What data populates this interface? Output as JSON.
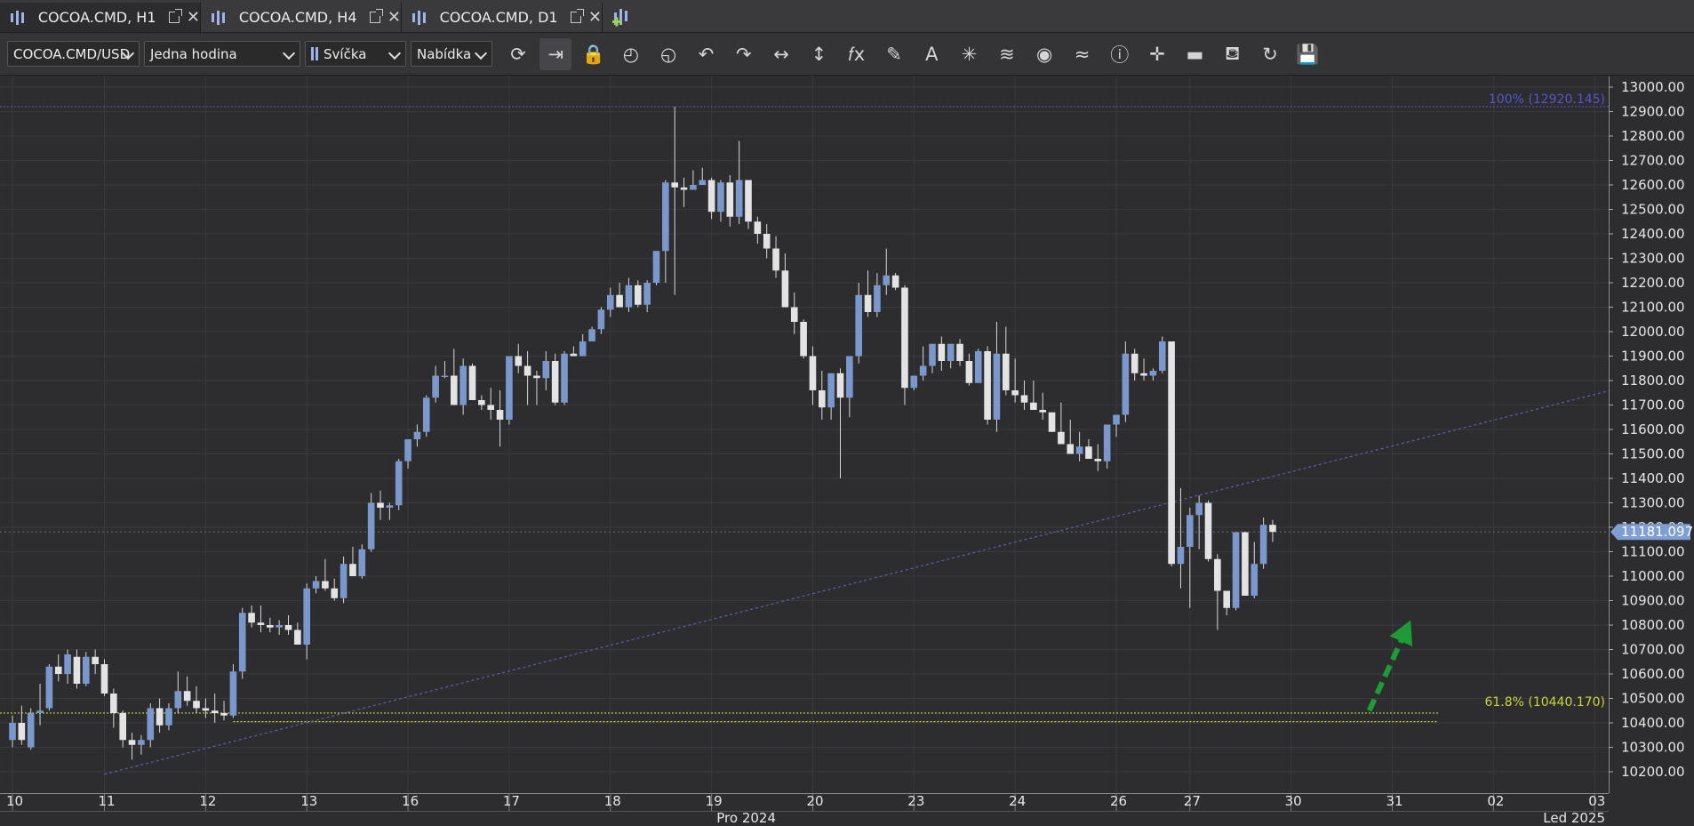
{
  "tabs": [
    {
      "label": "COCOA.CMD, H1",
      "active": true
    },
    {
      "label": "COCOA.CMD, H4",
      "active": false
    },
    {
      "label": "COCOA.CMD, D1",
      "active": false
    }
  ],
  "toolbar": {
    "instrument": "COCOA.CMD/USD",
    "period": "Jedna hodina",
    "chart_type": "Svíčka",
    "price_side": "Nabídka",
    "tools": [
      {
        "name": "refresh-icon",
        "glyph": "⟳"
      },
      {
        "name": "shift-chart-icon",
        "glyph": "⇥"
      },
      {
        "name": "lock-icon",
        "glyph": "🔒"
      },
      {
        "name": "zoom-icon",
        "glyph": "◴"
      },
      {
        "name": "zoom-out-icon",
        "glyph": "◵"
      },
      {
        "name": "undo-icon",
        "glyph": "↶"
      },
      {
        "name": "redo-icon",
        "glyph": "↷"
      },
      {
        "name": "horizontal-scale-icon",
        "glyph": "↔"
      },
      {
        "name": "vertical-scale-icon",
        "glyph": "↕"
      },
      {
        "name": "indicators-icon",
        "glyph": "𝑓x"
      },
      {
        "name": "pencil-icon",
        "glyph": "✎"
      },
      {
        "name": "text-tool-icon",
        "glyph": "A"
      },
      {
        "name": "fan-tool-icon",
        "glyph": "✳"
      },
      {
        "name": "layers-icon",
        "glyph": "≋"
      },
      {
        "name": "eye-icon",
        "glyph": "◉"
      },
      {
        "name": "chart-settings-icon",
        "glyph": "≈"
      },
      {
        "name": "info-icon",
        "glyph": "ⓘ"
      },
      {
        "name": "crosshair-icon",
        "glyph": "✛"
      },
      {
        "name": "color-bar-icon",
        "glyph": "▬"
      },
      {
        "name": "paint-bucket-icon",
        "glyph": "⛾"
      },
      {
        "name": "reload-icon",
        "glyph": "↻"
      },
      {
        "name": "save-icon",
        "glyph": "💾"
      }
    ]
  },
  "colors": {
    "bull": "#7b98cc",
    "bear": "#e3e3e3",
    "wick": "#d8d8d8",
    "grid": "#3a3a3c",
    "fib100": "#5656d0",
    "fib618": "#c8d43a",
    "trend": "#5b5fae",
    "arrow": "#1f9a38",
    "price_label_bg": "#7f9fd2"
  },
  "chart_data": {
    "type": "candlestick",
    "symbol": "COCOA.CMD/USD",
    "timeframe": "H1",
    "ylim": [
      10100,
      13050
    ],
    "y_ticks": [
      10200,
      10300,
      10400,
      10500,
      10600,
      10700,
      10800,
      10900,
      11000,
      11100,
      11200,
      11300,
      11400,
      11500,
      11600,
      11700,
      11800,
      11900,
      12000,
      12100,
      12200,
      12300,
      12400,
      12500,
      12600,
      12700,
      12800,
      12900,
      13000
    ],
    "y_tick_labels": [
      "10200.00",
      "10300.00",
      "10400.00",
      "10500.00",
      "10600.00",
      "10700.00",
      "10800.00",
      "10900.00",
      "11000.00",
      "11100.00",
      "11200.00",
      "11300.00",
      "11400.00",
      "11500.00",
      "11600.00",
      "11700.00",
      "11800.00",
      "11900.00",
      "12000.00",
      "12100.00",
      "12200.00",
      "12300.00",
      "12400.00",
      "12500.00",
      "12600.00",
      "12700.00",
      "12800.00",
      "12900.00",
      "13000.00"
    ],
    "x_ticks": [
      {
        "label": "10",
        "bar": 0
      },
      {
        "label": "11",
        "bar": 10
      },
      {
        "label": "12",
        "bar": 21
      },
      {
        "label": "13",
        "bar": 32
      },
      {
        "label": "16",
        "bar": 43
      },
      {
        "label": "17",
        "bar": 54
      },
      {
        "label": "18",
        "bar": 65
      },
      {
        "label": "19",
        "bar": 76
      },
      {
        "label": "20",
        "bar": 87
      },
      {
        "label": "23",
        "bar": 98
      },
      {
        "label": "24",
        "bar": 109
      },
      {
        "label": "26",
        "bar": 120
      },
      {
        "label": "27",
        "bar": 128
      },
      {
        "label": "30",
        "bar": 139
      },
      {
        "label": "31",
        "bar": 150
      },
      {
        "label": "02",
        "bar": 161
      },
      {
        "label": "03",
        "bar": 172
      }
    ],
    "month_labels": [
      {
        "label": "Pro 2024",
        "bar": 79
      },
      {
        "label": "Led 2025",
        "bar": 169
      }
    ],
    "current_price": "11181.097",
    "current_price_value": 11181.097,
    "fib_levels": [
      {
        "label": "100% (12920.145)",
        "value": 12920.145
      },
      {
        "label": "61.8% (10440.170)",
        "value": 10440.17
      }
    ],
    "fib_lower_value": 10405,
    "fib_start_bar": 24,
    "fib_end_bar": 155,
    "trendline": {
      "from": {
        "bar": 10,
        "value": 10190
      },
      "to": {
        "bar": 180,
        "value": 11820
      }
    },
    "arrow": {
      "from": {
        "bar": 147.5,
        "value": 10450
      },
      "to": {
        "bar": 152,
        "value": 10820
      }
    },
    "candles": [
      [
        10330,
        10430,
        10300,
        10400
      ],
      [
        10400,
        10470,
        10310,
        10330
      ],
      [
        10300,
        10460,
        10290,
        10440
      ],
      [
        10440,
        10560,
        10390,
        10450
      ],
      [
        10460,
        10640,
        10450,
        10630
      ],
      [
        10630,
        10680,
        10570,
        10600
      ],
      [
        10600,
        10700,
        10560,
        10680
      ],
      [
        10670,
        10700,
        10540,
        10560
      ],
      [
        10560,
        10690,
        10550,
        10670
      ],
      [
        10670,
        10700,
        10600,
        10640
      ],
      [
        10640,
        10660,
        10510,
        10520
      ],
      [
        10520,
        10540,
        10380,
        10440
      ],
      [
        10440,
        10450,
        10300,
        10330
      ],
      [
        10330,
        10360,
        10250,
        10310
      ],
      [
        10310,
        10350,
        10270,
        10330
      ],
      [
        10330,
        10480,
        10300,
        10460
      ],
      [
        10460,
        10500,
        10360,
        10390
      ],
      [
        10390,
        10480,
        10370,
        10460
      ],
      [
        10460,
        10610,
        10440,
        10530
      ],
      [
        10530,
        10590,
        10470,
        10490
      ],
      [
        10490,
        10550,
        10440,
        10460
      ],
      [
        10460,
        10500,
        10420,
        10450
      ],
      [
        10450,
        10520,
        10400,
        10440
      ],
      [
        10440,
        10490,
        10410,
        10430
      ],
      [
        10430,
        10640,
        10420,
        10610
      ],
      [
        10610,
        10870,
        10580,
        10850
      ],
      [
        10850,
        10880,
        10790,
        10810
      ],
      [
        10810,
        10880,
        10770,
        10800
      ],
      [
        10800,
        10830,
        10770,
        10790
      ],
      [
        10790,
        10820,
        10760,
        10800
      ],
      [
        10800,
        10840,
        10760,
        10780
      ],
      [
        10780,
        10810,
        10720,
        10720
      ],
      [
        10720,
        10970,
        10660,
        10950
      ],
      [
        10950,
        11000,
        10930,
        10980
      ],
      [
        10980,
        11070,
        10940,
        10950
      ],
      [
        10950,
        10990,
        10900,
        10910
      ],
      [
        10910,
        11080,
        10890,
        11050
      ],
      [
        11050,
        11120,
        11000,
        11000
      ],
      [
        11000,
        11130,
        10990,
        11110
      ],
      [
        11110,
        11340,
        11100,
        11300
      ],
      [
        11300,
        11350,
        11230,
        11280
      ],
      [
        11280,
        11300,
        11230,
        11290
      ],
      [
        11290,
        11480,
        11270,
        11470
      ],
      [
        11470,
        11560,
        11440,
        11560
      ],
      [
        11560,
        11620,
        11530,
        11590
      ],
      [
        11590,
        11740,
        11570,
        11730
      ],
      [
        11730,
        11860,
        11710,
        11820
      ],
      [
        11820,
        11880,
        11810,
        11820
      ],
      [
        11820,
        11930,
        11700,
        11700
      ],
      [
        11700,
        11890,
        11660,
        11860
      ],
      [
        11860,
        11870,
        11720,
        11720
      ],
      [
        11720,
        11740,
        11680,
        11700
      ],
      [
        11700,
        11770,
        11640,
        11680
      ],
      [
        11680,
        11760,
        11530,
        11640
      ],
      [
        11640,
        11900,
        11620,
        11900
      ],
      [
        11900,
        11950,
        11830,
        11860
      ],
      [
        11860,
        11920,
        11700,
        11820
      ],
      [
        11820,
        11840,
        11700,
        11810
      ],
      [
        11810,
        11920,
        11760,
        11880
      ],
      [
        11880,
        11910,
        11700,
        11710
      ],
      [
        11710,
        11920,
        11700,
        11910
      ],
      [
        11910,
        11940,
        11900,
        11900
      ],
      [
        11900,
        11990,
        11910,
        11960
      ],
      [
        11960,
        12020,
        11970,
        12010
      ],
      [
        12010,
        12100,
        11990,
        12090
      ],
      [
        12090,
        12180,
        12060,
        12150
      ],
      [
        12150,
        12200,
        12100,
        12100
      ],
      [
        12100,
        12220,
        12080,
        12190
      ],
      [
        12190,
        12210,
        12100,
        12110
      ],
      [
        12110,
        12210,
        12080,
        12200
      ],
      [
        12200,
        12330,
        12190,
        12330
      ],
      [
        12330,
        12620,
        12200,
        12610
      ],
      [
        12610,
        12920,
        12150,
        12590
      ],
      [
        12590,
        12630,
        12510,
        12580
      ],
      [
        12580,
        12660,
        12590,
        12600
      ],
      [
        12600,
        12670,
        12600,
        12620
      ],
      [
        12620,
        12630,
        12460,
        12490
      ],
      [
        12490,
        12620,
        12450,
        12610
      ],
      [
        12610,
        12640,
        12430,
        12470
      ],
      [
        12470,
        12780,
        12440,
        12620
      ],
      [
        12620,
        12620,
        12420,
        12450
      ],
      [
        12450,
        12470,
        12360,
        12400
      ],
      [
        12400,
        12440,
        12300,
        12340
      ],
      [
        12340,
        12390,
        12220,
        12250
      ],
      [
        12250,
        12320,
        12100,
        12100
      ],
      [
        12100,
        12160,
        11990,
        12040
      ],
      [
        12040,
        12050,
        11890,
        11900
      ],
      [
        11900,
        11940,
        11700,
        11760
      ],
      [
        11760,
        11840,
        11640,
        11690
      ],
      [
        11690,
        11830,
        11640,
        11830
      ],
      [
        11830,
        11850,
        11400,
        11730
      ],
      [
        11730,
        11900,
        11650,
        11900
      ],
      [
        11900,
        12200,
        11870,
        12150
      ],
      [
        12150,
        12250,
        12060,
        12080
      ],
      [
        12080,
        12240,
        12060,
        12190
      ],
      [
        12190,
        12340,
        12150,
        12230
      ],
      [
        12230,
        12240,
        12170,
        12180
      ],
      [
        12180,
        12190,
        11700,
        11770
      ],
      [
        11770,
        11820,
        11760,
        11820
      ],
      [
        11820,
        11940,
        11800,
        11860
      ],
      [
        11860,
        11950,
        11830,
        11950
      ],
      [
        11950,
        11980,
        11840,
        11880
      ],
      [
        11880,
        11950,
        11850,
        11950
      ],
      [
        11950,
        11970,
        11860,
        11880
      ],
      [
        11880,
        11910,
        11780,
        11790
      ],
      [
        11790,
        11930,
        11830,
        11920
      ],
      [
        11920,
        11940,
        11620,
        11640
      ],
      [
        11640,
        12040,
        11590,
        11910
      ],
      [
        11910,
        12020,
        11740,
        11760
      ],
      [
        11760,
        11890,
        11710,
        11740
      ],
      [
        11740,
        11800,
        11680,
        11710
      ],
      [
        11710,
        11800,
        11690,
        11680
      ],
      [
        11680,
        11750,
        11640,
        11670
      ],
      [
        11670,
        11640,
        11600,
        11590
      ],
      [
        11590,
        11710,
        11540,
        11540
      ],
      [
        11540,
        11640,
        11500,
        11500
      ],
      [
        11500,
        11590,
        11470,
        11530
      ],
      [
        11530,
        11560,
        11510,
        11480
      ],
      [
        11480,
        11540,
        11430,
        11470
      ],
      [
        11470,
        11550,
        11440,
        11620
      ],
      [
        11620,
        11660,
        11570,
        11660
      ],
      [
        11660,
        11960,
        11630,
        11910
      ],
      [
        11910,
        11930,
        11800,
        11830
      ],
      [
        11830,
        11890,
        11800,
        11820
      ],
      [
        11820,
        11850,
        11800,
        11840
      ],
      [
        11840,
        11980,
        11830,
        11960
      ],
      [
        11960,
        11950,
        11040,
        11050
      ],
      [
        11050,
        11360,
        10950,
        11120
      ],
      [
        11120,
        11280,
        10870,
        11250
      ],
      [
        11250,
        11330,
        11110,
        11300
      ],
      [
        11300,
        11310,
        11060,
        11070
      ],
      [
        11070,
        11090,
        10780,
        10940
      ],
      [
        10940,
        10930,
        10840,
        10870
      ],
      [
        10870,
        11180,
        10860,
        11180
      ],
      [
        11180,
        11180,
        10920,
        10920
      ],
      [
        10920,
        11140,
        10910,
        11050
      ],
      [
        11050,
        11240,
        11030,
        11210
      ],
      [
        11210,
        11230,
        11140,
        11181.097
      ]
    ]
  }
}
